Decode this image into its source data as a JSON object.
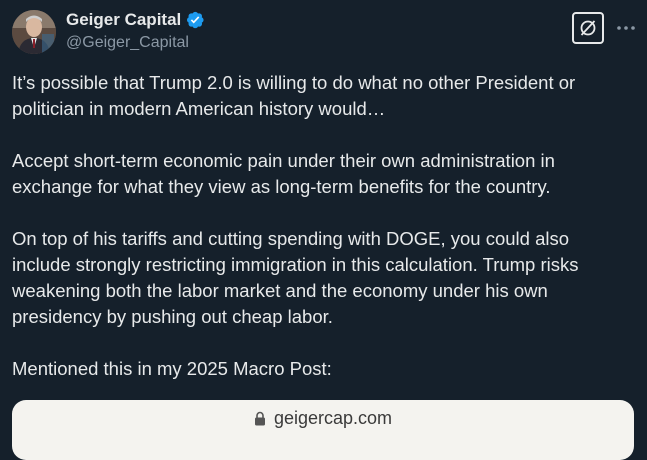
{
  "author": {
    "display_name": "Geiger Capital",
    "handle": "@Geiger_Capital",
    "verified": true,
    "avatar_icon": "profile-photo"
  },
  "actions": {
    "grok_icon": "grok-icon",
    "more_icon": "more-horizontal-icon"
  },
  "tweet": {
    "paragraphs": [
      "It’s possible that Trump 2.0 is willing to do what no other President or politician in modern American history would…",
      "Accept short-term economic pain under their own administration in exchange for what they view as long-term benefits for the country.",
      "On top of his tariffs and cutting spending with DOGE, you could also include strongly restricting immigration in this calculation. Trump risks weakening both the labor market and the economy under his own presidency by pushing out cheap labor.",
      "Mentioned this in my 2025 Macro Post:"
    ]
  },
  "link_card": {
    "domain": "geigercap.com",
    "lock_icon": "lock-icon"
  },
  "colors": {
    "background": "#15202b",
    "text": "#e7e9ea",
    "secondary_text": "#8b98a5",
    "verified_blue": "#1d9bf0",
    "card_background": "#f4f3ef"
  }
}
